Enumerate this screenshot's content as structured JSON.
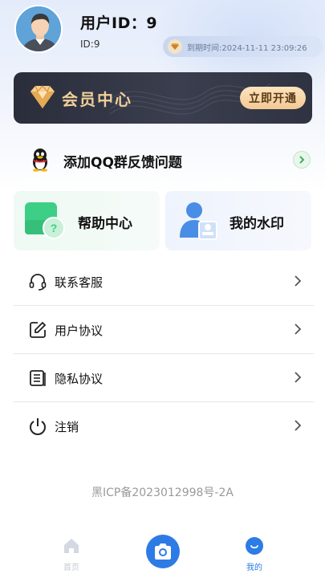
{
  "profile": {
    "username": "用户ID：9",
    "user_id": "ID:9",
    "expire_text": "到期时间:2024-11-11 23:09:26"
  },
  "vip": {
    "title": "会员中心",
    "open_label": "立即开通"
  },
  "qq_group": {
    "label": "添加QQ群反馈问题"
  },
  "cards": [
    {
      "label": "帮助中心",
      "icon": "help-center-icon"
    },
    {
      "label": "我的水印",
      "icon": "watermark-icon"
    }
  ],
  "menu": [
    {
      "label": "联系客服",
      "icon": "headset-icon"
    },
    {
      "label": "用户协议",
      "icon": "edit-document-icon"
    },
    {
      "label": "隐私协议",
      "icon": "document-list-icon"
    },
    {
      "label": "注销",
      "icon": "power-icon"
    }
  ],
  "icp": "黑ICP备2023012998号-2A",
  "nav": {
    "home_label": "首页",
    "mine_label": "我的"
  },
  "colors": {
    "accent": "#2d7be5",
    "vip_gold": "#f0cf9b",
    "vip_dark": "#2a2d3a"
  }
}
